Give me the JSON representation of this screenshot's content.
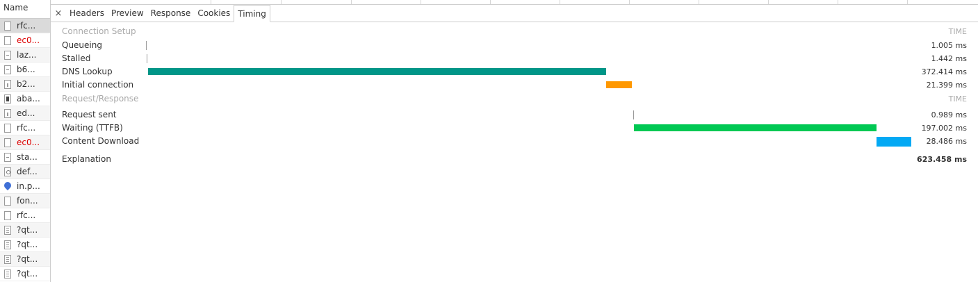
{
  "name_column": {
    "header": "Name",
    "items": [
      {
        "label": "rfc...",
        "icon": "file-icon",
        "color": "#333333",
        "selected": true
      },
      {
        "label": "ec0...",
        "icon": "file-icon",
        "color": "#dd0000"
      },
      {
        "label": "laz...",
        "icon": "script-file-icon",
        "color": "#333333"
      },
      {
        "label": "b6...",
        "icon": "script-file-icon",
        "color": "#333333"
      },
      {
        "label": "b2...",
        "icon": "image-file-icon",
        "color": "#333333"
      },
      {
        "label": "aba...",
        "icon": "dark-image-file-icon",
        "color": "#333333"
      },
      {
        "label": "ed...",
        "icon": "image-file-icon",
        "color": "#333333"
      },
      {
        "label": "rfc...",
        "icon": "file-icon",
        "color": "#333333"
      },
      {
        "label": "ec0...",
        "icon": "file-icon",
        "color": "#dd0000"
      },
      {
        "label": "sta...",
        "icon": "script-file-icon",
        "color": "#333333"
      },
      {
        "label": "def...",
        "icon": "gear-file-icon",
        "color": "#333333"
      },
      {
        "label": "in.p...",
        "icon": "location-pin-icon",
        "color": "#333333"
      },
      {
        "label": "fon...",
        "icon": "file-icon",
        "color": "#333333"
      },
      {
        "label": "rfc...",
        "icon": "file-icon",
        "color": "#333333"
      },
      {
        "label": "?qt...",
        "icon": "document-file-icon",
        "color": "#333333"
      },
      {
        "label": "?qt...",
        "icon": "document-file-icon",
        "color": "#333333"
      },
      {
        "label": "?qt...",
        "icon": "document-file-icon",
        "color": "#333333"
      },
      {
        "label": "?qt...",
        "icon": "document-file-icon",
        "color": "#333333"
      }
    ]
  },
  "tabs": {
    "close_symbol": "×",
    "items": [
      "Headers",
      "Preview",
      "Response",
      "Cookies",
      "Timing"
    ],
    "active": "Timing"
  },
  "timing": {
    "connection_setup": {
      "title": "Connection Setup",
      "time_header": "TIME",
      "phases": [
        {
          "label": "Queueing",
          "value": "1.005 ms"
        },
        {
          "label": "Stalled",
          "value": "1.442 ms"
        },
        {
          "label": "DNS Lookup",
          "value": "372.414 ms"
        },
        {
          "label": "Initial connection",
          "value": "21.399 ms"
        }
      ]
    },
    "request_response": {
      "title": "Request/Response",
      "time_header": "TIME",
      "phases": [
        {
          "label": "Request sent",
          "value": "0.989 ms"
        },
        {
          "label": "Waiting (TTFB)",
          "value": "197.002 ms"
        },
        {
          "label": "Content Download",
          "value": "28.486 ms"
        }
      ]
    },
    "explanation_link": "Explanation",
    "total": "623.458 ms",
    "colors": {
      "dns": "#009688",
      "initial_connection": "#ff9800",
      "waiting": "#00c853",
      "content_download": "#03a9f4",
      "tick": "#999999",
      "link": "#1a0dab"
    }
  }
}
